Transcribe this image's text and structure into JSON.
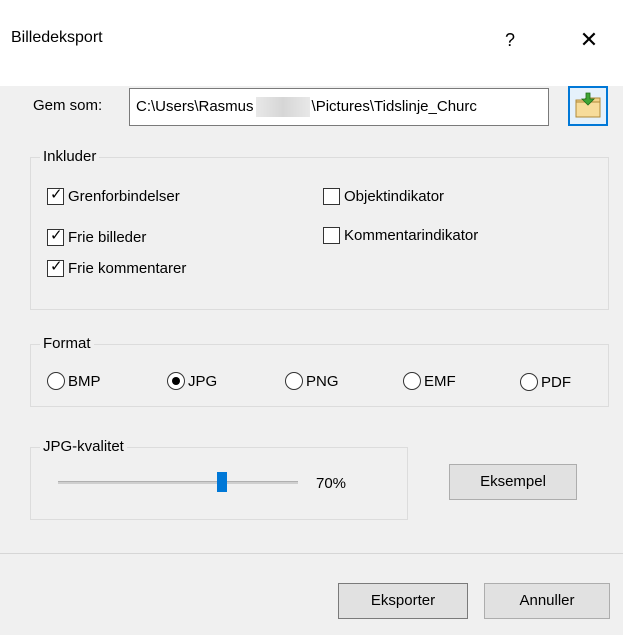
{
  "window": {
    "title": "Billedeksport",
    "help_label": "?",
    "close_label": "✕"
  },
  "save_as": {
    "label": "Gem som:",
    "path_prefix": "C:\\Users\\Rasmus",
    "path_suffix": "\\Pictures\\Tidslinje_Churc",
    "browse_icon": "folder-arrow-icon"
  },
  "include": {
    "legend": "Inkluder",
    "items": [
      {
        "label": "Grenforbindelser",
        "checked": true
      },
      {
        "label": "Frie billeder",
        "checked": true
      },
      {
        "label": "Frie kommentarer",
        "checked": true
      },
      {
        "label": "Objektindikator",
        "checked": false
      },
      {
        "label": "Kommentarindikator",
        "checked": false
      }
    ]
  },
  "format": {
    "legend": "Format",
    "options": [
      "BMP",
      "JPG",
      "PNG",
      "EMF",
      "PDF"
    ],
    "selected": "JPG"
  },
  "quality": {
    "legend": "JPG-kvalitet",
    "value": 70,
    "value_label": "70%",
    "preview_label": "Eksempel"
  },
  "footer": {
    "export_label": "Eksporter",
    "cancel_label": "Annuller"
  },
  "colors": {
    "accent": "#0078d7",
    "background": "#f0f0f0"
  }
}
